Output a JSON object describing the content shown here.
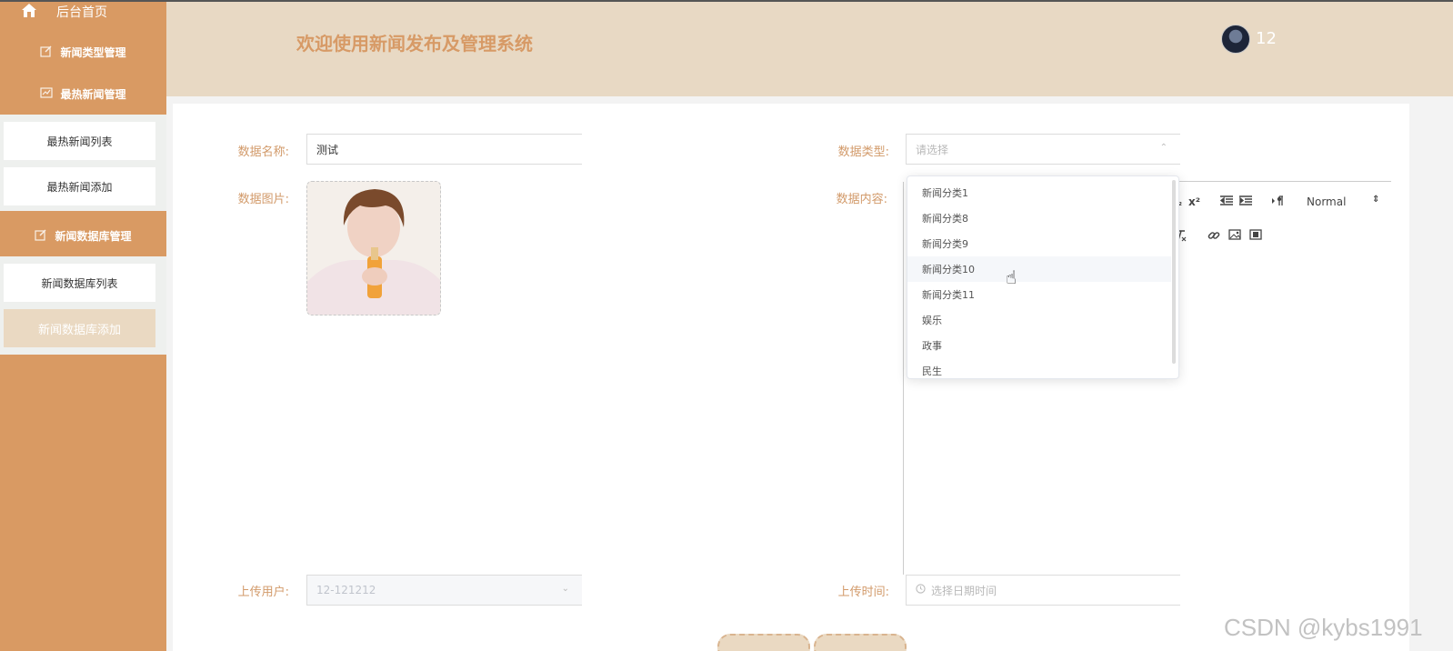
{
  "sidebar": {
    "home_label": "后台首页",
    "groups": [
      {
        "label": "新闻类型管理"
      },
      {
        "label": "最热新闻管理"
      },
      {
        "label": "新闻数据库管理"
      }
    ],
    "items": [
      {
        "label": "最热新闻列表"
      },
      {
        "label": "最热新闻添加"
      },
      {
        "label": "新闻数据库列表"
      },
      {
        "label": "新闻数据库添加"
      }
    ]
  },
  "header": {
    "title": "欢迎使用新闻发布及管理系统",
    "username": "12"
  },
  "form": {
    "name_label": "数据名称:",
    "name_value": "测试",
    "type_label": "数据类型:",
    "type_placeholder": "请选择",
    "image_label": "数据图片:",
    "content_label": "数据内容:",
    "user_label": "上传用户:",
    "user_value": "12-121212",
    "time_label": "上传时间:",
    "time_placeholder": "选择日期时间"
  },
  "editor": {
    "sub_glyph": "₂",
    "sup_glyph": "x²",
    "size_select": "Normal"
  },
  "dropdown": {
    "options": [
      "新闻分类1",
      "新闻分类8",
      "新闻分类9",
      "新闻分类10",
      "新闻分类11",
      "娱乐",
      "政事",
      "民生"
    ],
    "hovered": "新闻分类10"
  },
  "watermark": "CSDN @kybs1991",
  "colors": {
    "sidebar": "#d99a63",
    "header": "#e8d9c4",
    "accent": "#d79a66",
    "active_item": "#ead9c2"
  }
}
